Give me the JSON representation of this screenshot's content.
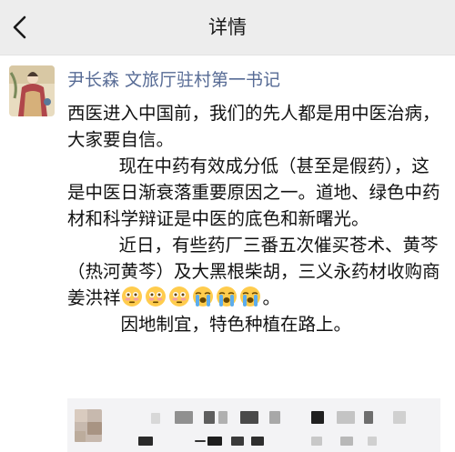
{
  "nav": {
    "title": "详情"
  },
  "post": {
    "author": "尹长森 文旅厅驻村第一书记",
    "paragraphs": [
      "西医进入中国前，我们的先人都是用中医治病，大家要自信。",
      "现在中药有效成分低（甚至是假药），这是中医日渐衰落重要原因之一。道地、绿色中药材和科学辩证是中医的底色和新曙光。",
      "近日，有些药厂三番五次催买苍术、黄芩（热河黄芩）及大黑根柴胡，三义永药材收购商姜洪祥",
      "因地制宜，特色种植在路上。"
    ],
    "period": "。",
    "emojis": [
      "flushed-face-icon",
      "flushed-face-icon",
      "flushed-face-icon",
      "loudly-crying-face-icon",
      "loudly-crying-face-icon",
      "loudly-crying-face-icon"
    ]
  },
  "colors": {
    "nav_background": "#ededed",
    "author_link": "#576b95",
    "text": "#111111",
    "comment_background": "#f3f3f5"
  }
}
